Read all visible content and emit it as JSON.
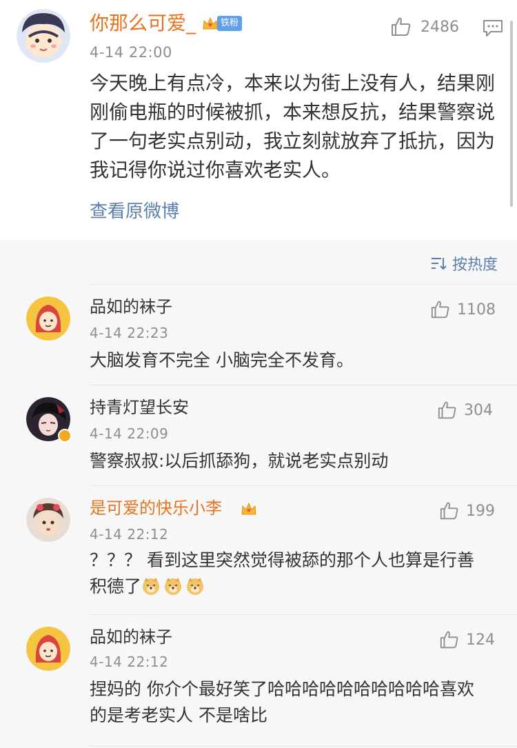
{
  "post": {
    "author": "你那么可爱_",
    "fan_badge": "铁粉",
    "time": "4-14 22:00",
    "likes": "2486",
    "content": "今天晚上有点冷，本来以为街上没有人，结果刚刚偷电瓶的时候被抓，本来想反抗，结果警察说了一句老实点别动，我立刻就放弃了抵抗，因为我记得你说过你喜欢老实人。",
    "view_original": "查看原微博"
  },
  "sort": {
    "label": "按热度"
  },
  "comments": [
    {
      "author": "品如的袜子",
      "time": "4-14 22:23",
      "likes": "1108",
      "text": "大脑发育不完全 小脑完全不发育。"
    },
    {
      "author": "持青灯望长安",
      "time": "4-14 22:09",
      "likes": "304",
      "text": "警察叔叔:以后抓舔狗，就说老实点别动"
    },
    {
      "author": "是可爱的快乐小李",
      "time": "4-14 22:12",
      "likes": "199",
      "text": "？？？ 看到这里突然觉得被舔的那个人也算是行善积德了"
    },
    {
      "author": "品如的袜子",
      "time": "4-14 22:12",
      "likes": "124",
      "text": "捏妈的 你介个最好笑了哈哈哈哈哈哈哈哈哈哈喜欢的是考老实人 不是啥比"
    }
  ],
  "colors": {
    "vip_name": "#e8731f",
    "link": "#5b7fac",
    "meta": "#8e8e8e",
    "badge": "#5fa0e9"
  }
}
